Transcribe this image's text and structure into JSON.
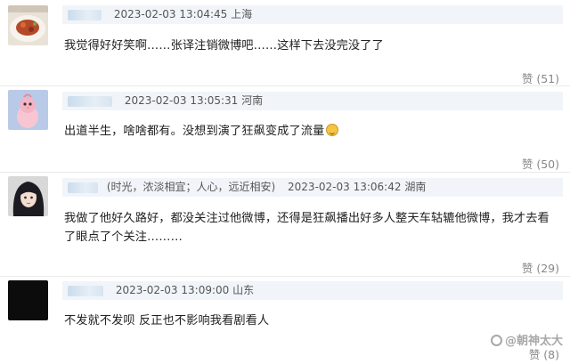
{
  "comments": [
    {
      "timestamp": "2023-02-03 13:04:45",
      "location": "上海",
      "nickname": "",
      "text": "我觉得好好笑啊……张译注销微博吧……这样下去没完没了了",
      "likes_label": "赞 (51)",
      "avatar_icon": "food-dish-avatar"
    },
    {
      "timestamp": "2023-02-03 13:05:31",
      "location": "河南",
      "nickname": "",
      "text": "出道半生，啥啥都有。没想到演了狂飙变成了流量",
      "emoji": "laughing-emoji",
      "likes_label": "赞 (50)",
      "avatar_icon": "pink-bird-avatar"
    },
    {
      "timestamp": "2023-02-03 13:06:42",
      "location": "湖南",
      "nickname": "(时光，浓淡相宜；人心，远近相安)",
      "text": "我做了他好久路好，都没关注过他微博，还得是狂飙播出好多人整天车轱辘他微博，我才去看了眼点了个关注………",
      "likes_label": "赞 (29)",
      "avatar_icon": "anime-character-avatar"
    },
    {
      "timestamp": "2023-02-03 13:09:00",
      "location": "山东",
      "nickname": "",
      "text": "不发就不发呗 反正也不影响我看剧看人",
      "likes_label": "赞 (8)",
      "avatar_icon": "black-avatar"
    }
  ],
  "watermark": "@朝神太大"
}
